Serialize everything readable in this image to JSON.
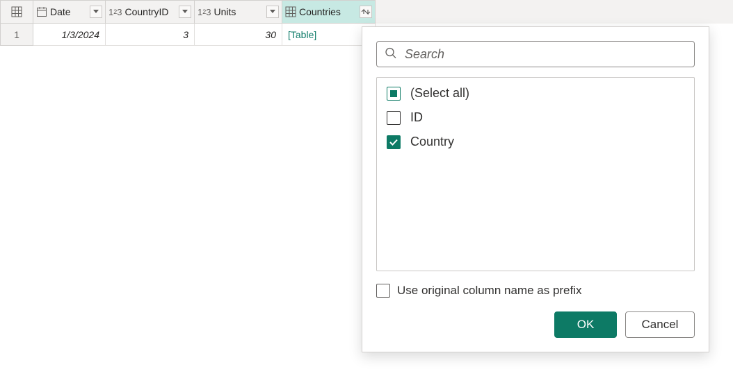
{
  "columns": {
    "date": {
      "label": "Date"
    },
    "cid": {
      "label": "CountryID"
    },
    "units": {
      "label": "Units"
    },
    "ctry": {
      "label": "Countries"
    }
  },
  "row": {
    "index": "1",
    "date": "1/3/2024",
    "cid": "3",
    "units": "30",
    "ctry": "[Table]"
  },
  "popup": {
    "search_placeholder": "Search",
    "select_all": "(Select all)",
    "fields": {
      "id": "ID",
      "country": "Country"
    },
    "prefix_label": "Use original column name as prefix",
    "ok": "OK",
    "cancel": "Cancel"
  }
}
